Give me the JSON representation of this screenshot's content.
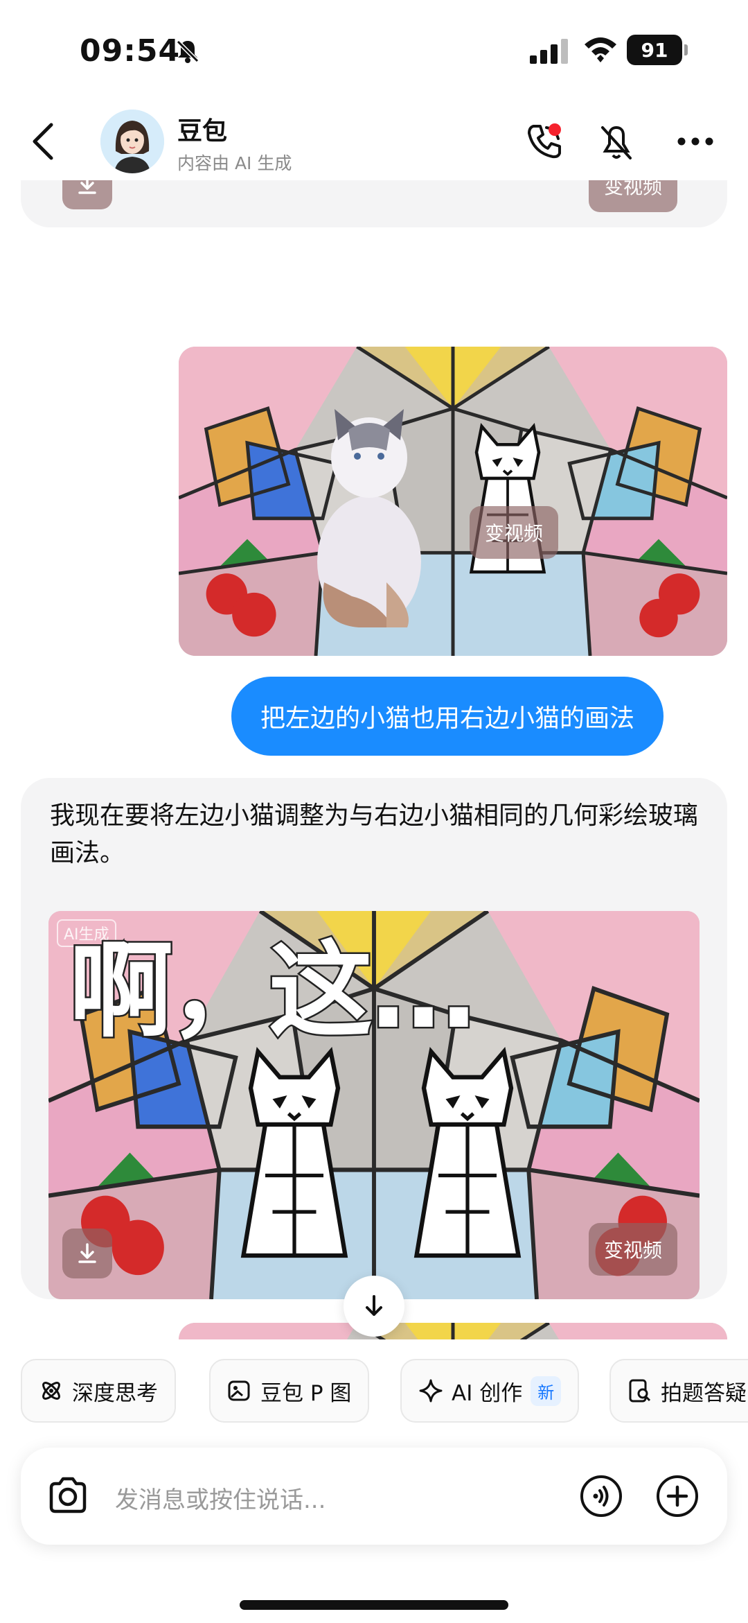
{
  "status": {
    "time": "09:54",
    "battery": "91",
    "icons": [
      "bell-slash-icon",
      "signal-icon",
      "wifi-icon",
      "battery-icon"
    ]
  },
  "header": {
    "name": "豆包",
    "subtitle": "内容由 AI 生成",
    "icons": [
      "back-icon",
      "phone-call-icon",
      "mute-icon",
      "more-icon"
    ],
    "notification_color": "#f5222d"
  },
  "messages": {
    "top_card": {
      "video_label": "变视频"
    },
    "user_image": {
      "video_label": "变视频"
    },
    "user_text": "把左边的小猫也用右边小猫的画法",
    "bot_reply": {
      "text": "我现在要将左边小猫调整为与右边小猫相同的几何彩绘玻璃画法。",
      "image_caption": "啊，这...",
      "image_badge": "AI生成",
      "video_label": "变视频"
    }
  },
  "chips": [
    {
      "label": "深度思考",
      "icon": "atom-icon"
    },
    {
      "label": "豆包 P 图",
      "icon": "image-edit-icon"
    },
    {
      "label": "AI 创作",
      "icon": "sparkle-icon",
      "badge": "新"
    },
    {
      "label": "拍题答疑",
      "icon": "photo-search-icon"
    }
  ],
  "input": {
    "placeholder": "发消息或按住说话...",
    "icons": [
      "camera-icon",
      "voice-icon",
      "plus-icon"
    ]
  },
  "colors": {
    "accent": "#1a8cff",
    "card_bg": "#f4f4f5"
  }
}
